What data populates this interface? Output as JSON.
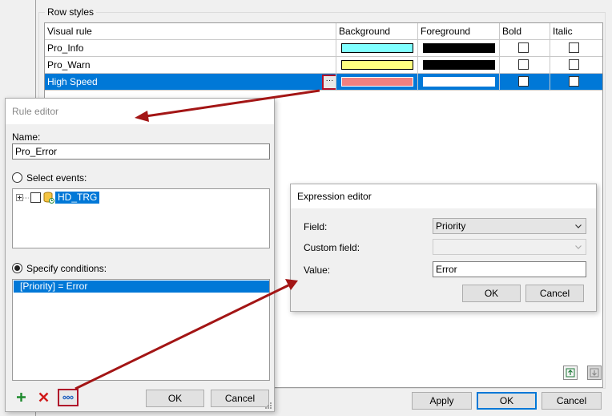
{
  "row_styles": {
    "group_title": "Row styles",
    "columns": [
      "Visual rule",
      "Background",
      "Foreground",
      "Bold",
      "Italic"
    ],
    "rows": [
      {
        "name": "Pro_Info",
        "background": "#80ffff",
        "foreground": "#000000",
        "bold": false,
        "italic": false,
        "selected": false
      },
      {
        "name": "Pro_Warn",
        "background": "#ffff80",
        "foreground": "#000000",
        "bold": false,
        "italic": false,
        "selected": false
      },
      {
        "name": "High Speed",
        "background": "#f08080",
        "foreground": "#ffffff",
        "bold": false,
        "italic": false,
        "selected": true
      }
    ],
    "edit_button_label": "···"
  },
  "outer_buttons": {
    "apply": "Apply",
    "ok": "OK",
    "cancel": "Cancel"
  },
  "rule_editor": {
    "title": "Rule editor",
    "name_label": "Name:",
    "name_value": "Pro_Error",
    "select_events_label": "Select events:",
    "tree_item": "HD_TRG",
    "specify_conditions_label": "Specify conditions:",
    "condition": "[Priority] = Error",
    "ok": "OK",
    "cancel": "Cancel"
  },
  "expression_editor": {
    "title": "Expression editor",
    "field_label": "Field:",
    "field_value": "Priority",
    "custom_field_label": "Custom field:",
    "custom_field_value": "",
    "value_label": "Value:",
    "value_value": "Error",
    "ok": "OK",
    "cancel": "Cancel"
  },
  "colors": {
    "selection": "#0078d7",
    "highlight_border": "#b0102a",
    "arrow": "#a31515"
  }
}
